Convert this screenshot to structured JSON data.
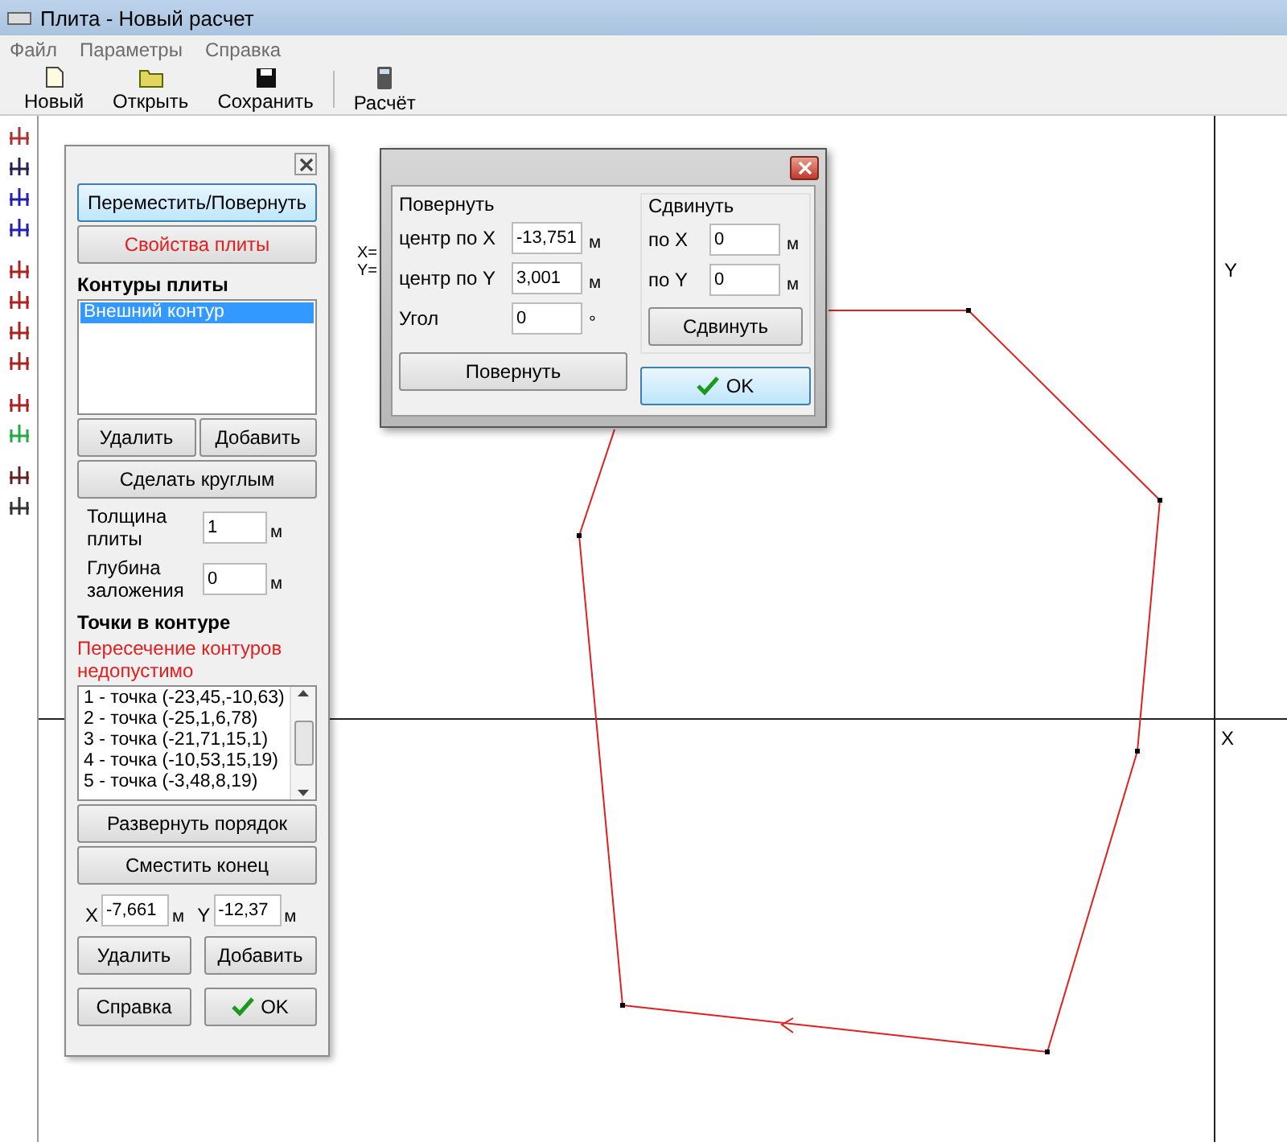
{
  "window": {
    "title": "Плита - Новый расчет"
  },
  "menu": [
    "Файл",
    "Параметры",
    "Справка"
  ],
  "toolbar": [
    {
      "label": "Новый",
      "kind": "new"
    },
    {
      "label": "Открыть",
      "kind": "open"
    },
    {
      "label": "Сохранить",
      "kind": "save"
    },
    {
      "label": "Расчёт",
      "kind": "calc"
    }
  ],
  "panel": {
    "move_button": "Переместить/Повернуть",
    "properties_button": "Свойства плиты",
    "contours_title": "Контуры плиты",
    "contours": [
      {
        "label": "Внешний контур",
        "selected": true
      }
    ],
    "delete": "Удалить",
    "add": "Добавить",
    "make_round": "Сделать круглым",
    "fields": [
      {
        "label": "Толщина плиты",
        "value": "1",
        "unit": "м"
      },
      {
        "label": "Глубина заложения",
        "value": "0",
        "unit": "м"
      }
    ],
    "points_title": "Точки в контуре",
    "warning": "Пересечение контуров недопустимо",
    "points": [
      "1 - точка (-23,45,-10,63)",
      "2 - точка (-25,1,6,78)",
      "3 - точка (-21,71,15,1)",
      "4 - точка (-10,53,15,19)",
      "5 - точка (-3,48,8,19)"
    ],
    "reverse": "Развернуть порядок",
    "shift_end": "Сместить конец",
    "coords": [
      {
        "label": "X",
        "value": "-7,661",
        "unit": "м"
      },
      {
        "label": "Y",
        "value": "-12,37",
        "unit": "м"
      }
    ],
    "delete_point": "Удалить",
    "add_point": "Добавить",
    "help": "Справка",
    "ok": "OK"
  },
  "dialog": {
    "rotate": {
      "title": "Повернуть",
      "fields": [
        {
          "label": "центр по X",
          "value": "-13,751",
          "unit": "м"
        },
        {
          "label": "центр по Y",
          "value": "3,001",
          "unit": "м"
        },
        {
          "label": "Угол",
          "value": "0",
          "unit": "°"
        }
      ],
      "button": "Повернуть"
    },
    "move": {
      "title": "Сдвинуть",
      "fields": [
        {
          "label": "по X",
          "value": "0",
          "unit": "м"
        },
        {
          "label": "по Y",
          "value": "0",
          "unit": "м"
        }
      ],
      "button": "Сдвинуть"
    },
    "ok": "OK"
  },
  "canvas": {
    "x_axis": "X",
    "y_axis": "Y",
    "cursor": [
      "X=",
      "Y="
    ]
  }
}
